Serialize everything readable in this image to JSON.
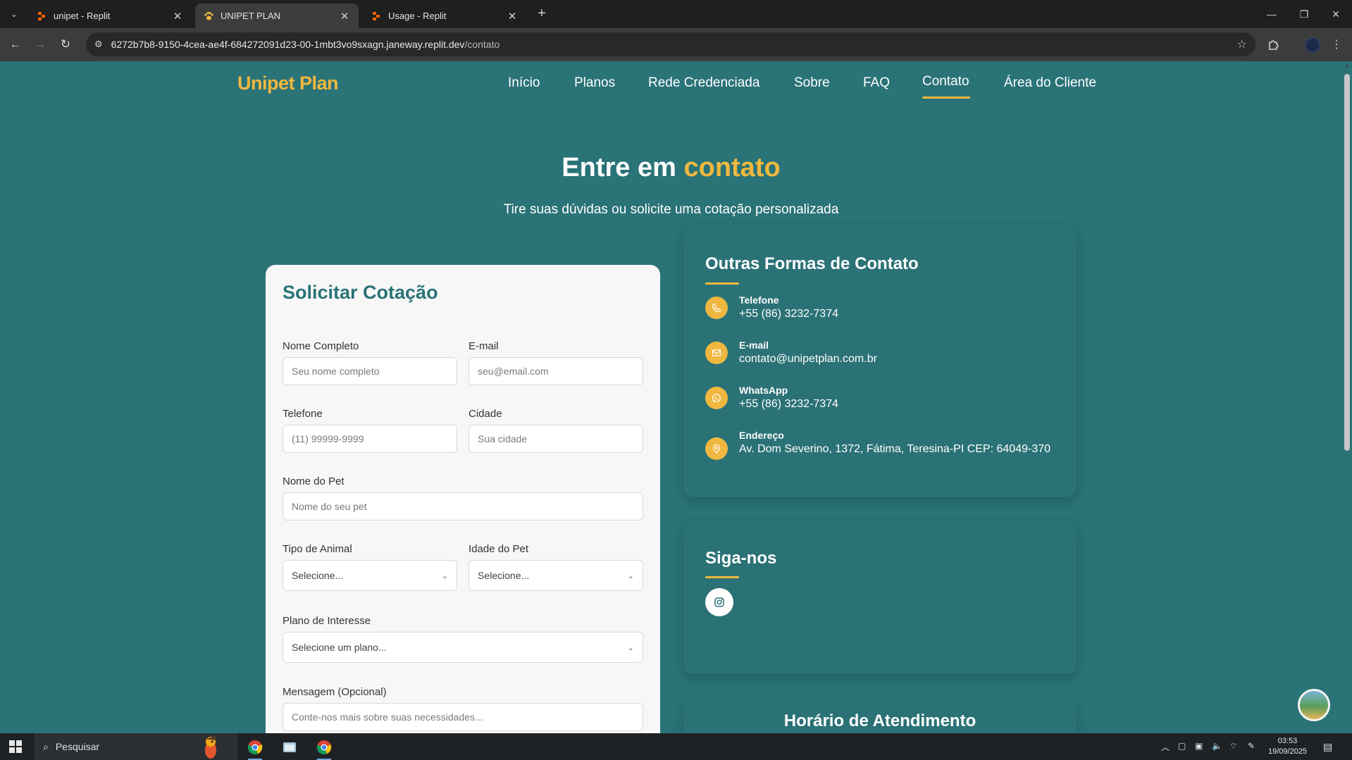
{
  "browser": {
    "tabs": [
      {
        "title": "unipet - Replit",
        "favicon": "replit-icon"
      },
      {
        "title": "UNIPET PLAN",
        "favicon": "paw-icon"
      },
      {
        "title": "Usage - Replit",
        "favicon": "replit-icon"
      }
    ],
    "url_host": "6272b7b8-9150-4cea-ae4f-684272091d23-00-1mbt3vo9sxagn.janeway.replit.dev",
    "url_path": "/contato"
  },
  "site": {
    "logo": "Unipet Plan",
    "nav": [
      "Início",
      "Planos",
      "Rede Credenciada",
      "Sobre",
      "FAQ",
      "Contato",
      "Área do Cliente"
    ],
    "active_nav": "Contato",
    "accent_color": "#f0b840",
    "bg_color": "#2a7377"
  },
  "hero": {
    "title_prefix": "Entre em ",
    "title_accent": "contato",
    "subtitle": "Tire suas dúvidas ou solicite uma cotação personalizada"
  },
  "form": {
    "title": "Solicitar Cotação",
    "name_label": "Nome Completo",
    "name_placeholder": "Seu nome completo",
    "email_label": "E-mail",
    "email_placeholder": "seu@email.com",
    "phone_label": "Telefone",
    "phone_placeholder": "(11) 99999-9999",
    "city_label": "Cidade",
    "city_placeholder": "Sua cidade",
    "pet_name_label": "Nome do Pet",
    "pet_name_placeholder": "Nome do seu pet",
    "animal_type_label": "Tipo de Animal",
    "animal_type_value": "Selecione...",
    "pet_age_label": "Idade do Pet",
    "pet_age_value": "Selecione...",
    "plan_label": "Plano de Interesse",
    "plan_value": "Selecione um plano...",
    "message_label": "Mensagem (Opcional)",
    "message_placeholder": "Conte-nos mais sobre suas necessidades..."
  },
  "contact": {
    "title": "Outras Formas de Contato",
    "items": [
      {
        "icon": "phone-icon",
        "label": "Telefone",
        "value": "+55 (86) 3232-7374"
      },
      {
        "icon": "mail-icon",
        "label": "E-mail",
        "value": "contato@unipetplan.com.br"
      },
      {
        "icon": "whatsapp-icon",
        "label": "WhatsApp",
        "value": "+55 (86) 3232-7374"
      },
      {
        "icon": "map-pin-icon",
        "label": "Endereço",
        "value": "Av. Dom Severino, 1372, Fátima, Teresina-PI CEP: 64049-370"
      }
    ]
  },
  "social": {
    "title": "Siga-nos",
    "icons": [
      "instagram-icon"
    ]
  },
  "hours": {
    "title": "Horário de Atendimento"
  },
  "taskbar": {
    "search_placeholder": "Pesquisar",
    "time": "03:53",
    "date": "19/09/2025"
  }
}
